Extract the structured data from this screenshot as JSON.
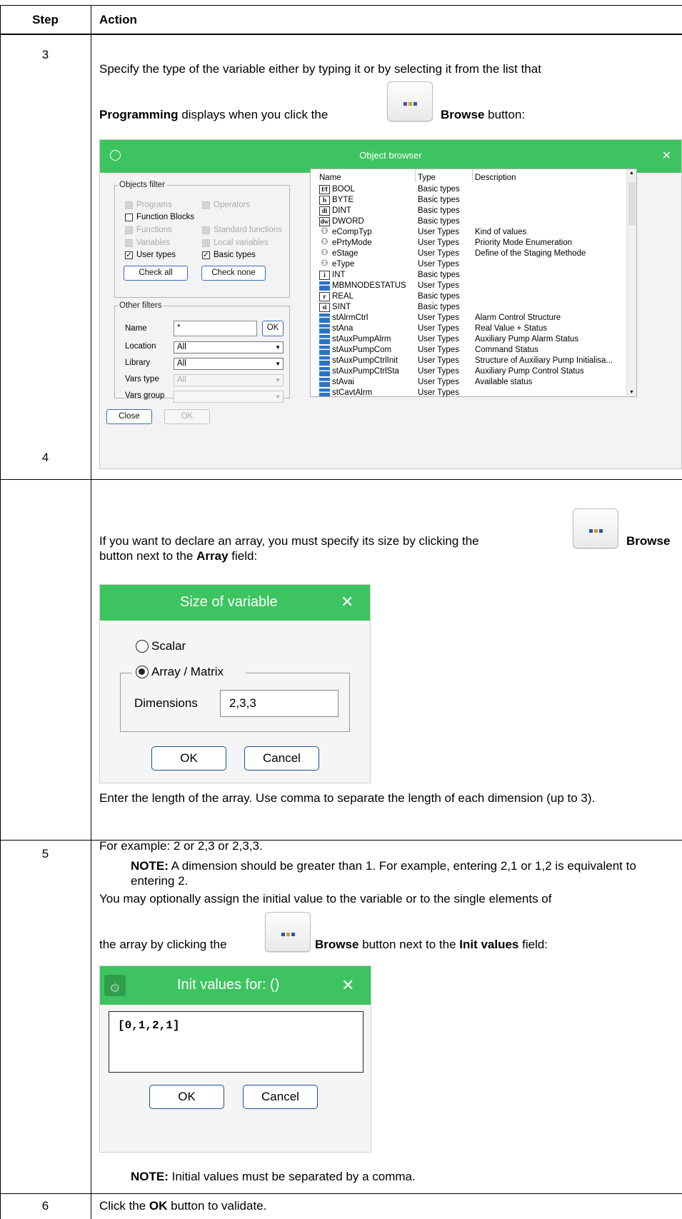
{
  "header": {
    "step": "Step",
    "action": "Action"
  },
  "step3": {
    "number": "3",
    "line1": "Specify the type of the variable either by typing it or by selecting it from the list that",
    "line2_bold": "Programming",
    "line2_mid": " displays when you click the",
    "browse_bold": "Browse",
    "line2_end": " button:",
    "object_browser": {
      "title": "Object browser",
      "objects_filter": {
        "legend": "Objects filter",
        "programs": "Programs",
        "operators": "Operators",
        "function_blocks": "Function Blocks",
        "functions": "Functions",
        "standard_functions": "Standard functions",
        "variables": "Variables",
        "local_variables": "Local variables",
        "user_types": "User types",
        "basic_types": "Basic types",
        "check_all": "Check all",
        "check_none": "Check none"
      },
      "other_filters": {
        "legend": "Other filters",
        "name_label": "Name",
        "name_value": "*",
        "ok": "OK",
        "location_label": "Location",
        "location_value": "All",
        "library_label": "Library",
        "library_value": "All",
        "vars_type_label": "Vars type",
        "vars_type_value": "All",
        "vars_group_label": "Vars group",
        "vars_group_value": ""
      },
      "columns": [
        "Name",
        "Type",
        "Description"
      ],
      "rows": [
        {
          "icon": "f/f",
          "name": "BOOL",
          "type": "Basic types",
          "desc": ""
        },
        {
          "icon": "b",
          "name": "BYTE",
          "type": "Basic types",
          "desc": ""
        },
        {
          "icon": "di",
          "name": "DINT",
          "type": "Basic types",
          "desc": ""
        },
        {
          "icon": "dw",
          "name": "DWORD",
          "type": "Basic types",
          "desc": ""
        },
        {
          "icon": "ut",
          "name": "eCompTyp",
          "type": "User Types",
          "desc": "Kind of values"
        },
        {
          "icon": "ut",
          "name": "ePrtyMode",
          "type": "User Types",
          "desc": "Priority Mode Enumeration"
        },
        {
          "icon": "ut",
          "name": "eStage",
          "type": "User Types",
          "desc": "Define of the Staging Methode"
        },
        {
          "icon": "ut",
          "name": "eType",
          "type": "User Types",
          "desc": ""
        },
        {
          "icon": "i",
          "name": "INT",
          "type": "Basic types",
          "desc": ""
        },
        {
          "icon": "st",
          "name": "MBMNODESTATUS",
          "type": "User Types",
          "desc": ""
        },
        {
          "icon": "r",
          "name": "REAL",
          "type": "Basic types",
          "desc": ""
        },
        {
          "icon": "si",
          "name": "SINT",
          "type": "Basic types",
          "desc": ""
        },
        {
          "icon": "st",
          "name": "stAlrmCtrl",
          "type": "User Types",
          "desc": "Alarm Control Structure"
        },
        {
          "icon": "st",
          "name": "stAna",
          "type": "User Types",
          "desc": "Real Value + Status"
        },
        {
          "icon": "st",
          "name": "stAuxPumpAlrm",
          "type": "User Types",
          "desc": "Auxiliary Pump Alarm Status"
        },
        {
          "icon": "st",
          "name": "stAuxPumpCom",
          "type": "User Types",
          "desc": "Command Status"
        },
        {
          "icon": "st",
          "name": "stAuxPumpCtrlInit",
          "type": "User Types",
          "desc": "Structure of Auxiliary Pump Initialisa..."
        },
        {
          "icon": "st",
          "name": "stAuxPumpCtrlSta",
          "type": "User Types",
          "desc": "Auxiliary Pump Control Status"
        },
        {
          "icon": "st",
          "name": "stAvai",
          "type": "User Types",
          "desc": "Available status"
        },
        {
          "icon": "st",
          "name": "stCavtAlrm",
          "type": "User Types",
          "desc": ""
        }
      ],
      "close": "Close",
      "ok": "OK"
    }
  },
  "step4": {
    "number": "4",
    "line1": "If you want to declare an array, you must specify its size by clicking the",
    "browse_bold": "Browse",
    "line2_a": "button next to the ",
    "array_bold": "Array",
    "line2_b": " field:",
    "dialog": {
      "title": "Size of variable",
      "scalar": "Scalar",
      "array": "Array / Matrix",
      "dimensions_label": "Dimensions",
      "dimensions_value": "2,3,3",
      "ok": "OK",
      "cancel": "Cancel"
    },
    "para1": "Enter the length of the array. Use comma to separate the length of each dimension (up to 3).",
    "para2": "For example: 2 or 2,3 or 2,3,3.",
    "note_bold": "NOTE:",
    "note_text": " A dimension should be greater than 1. For example, entering 2,1 or 1,2 is equivalent to entering 2."
  },
  "step5": {
    "number": "5",
    "line1": "You may optionally assign the initial value to the variable or to the single elements of",
    "line2_a": "the array by clicking the",
    "browse_bold": "Browse",
    "line2_b": " button next to the ",
    "init_bold": "Init values",
    "line2_c": " field:",
    "dialog": {
      "title": "Init values for: ()",
      "value": "[0,1,2,1]",
      "ok": "OK",
      "cancel": "Cancel"
    },
    "note_bold": "NOTE:",
    "note_text": " Initial values must be separated by a comma."
  },
  "step6": {
    "number": "6",
    "text_a": "Click the ",
    "ok_bold": "OK",
    "text_b": " button to validate."
  },
  "colors": {
    "accent_green": "#3dc460",
    "button_border": "#1d4f8f"
  }
}
